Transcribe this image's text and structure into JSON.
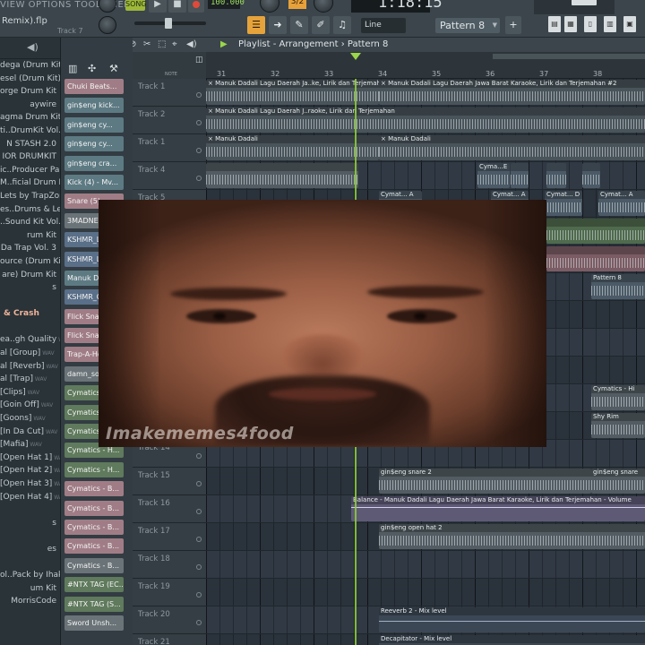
{
  "topbar": {
    "menu_text": "VIEW  OPTIONS  TOOLS  HELP",
    "file_name": "Remix).flp",
    "track_hint": "Track 7",
    "song_label": "SONG",
    "tempo": "100.000",
    "snap_value": "3/2",
    "time": "1:18:15",
    "snap_mode": "Line",
    "pattern": "Pattern 8"
  },
  "browser": {
    "items": [
      {
        "label": "dega (Drum Kit)",
        "kind": "item"
      },
      {
        "label": "esel (Drum Kit)",
        "kind": "item"
      },
      {
        "label": "orge Drum Kit",
        "kind": "item"
      },
      {
        "label": "aywire",
        "kind": "item"
      },
      {
        "label": "agma Drum Kit",
        "kind": "item"
      },
      {
        "label": "ti..DrumKit Vol. 3",
        "kind": "item"
      },
      {
        "label": "N STASH 2.0",
        "kind": "item"
      },
      {
        "label": "IOR DRUMKIT",
        "kind": "item"
      },
      {
        "label": "ic..Producer Pack",
        "kind": "item"
      },
      {
        "label": "M..ficial Drum Kit",
        "kind": "item"
      },
      {
        "label": "Lets by TrapZone",
        "kind": "item"
      },
      {
        "label": "es..Drums & Leads",
        "kind": "item"
      },
      {
        "label": "..Sound Kit Vol.8",
        "kind": "item"
      },
      {
        "label": "rum Kit",
        "kind": "item"
      },
      {
        "label": "Da Trap Vol. 3",
        "kind": "item"
      },
      {
        "label": "ource (Drum Kit)",
        "kind": "item"
      },
      {
        "label": "are) Drum Kit",
        "kind": "item"
      },
      {
        "label": "s",
        "kind": "item"
      },
      {
        "label": "",
        "kind": "item"
      },
      {
        "label": "& Crash",
        "kind": "group"
      },
      {
        "label": "",
        "kind": "item"
      },
      {
        "label": "ea..gh Quality",
        "kind": "audio"
      },
      {
        "label": "al [Group]",
        "kind": "audio"
      },
      {
        "label": "al [Reverb]",
        "kind": "audio"
      },
      {
        "label": "al [Trap]",
        "kind": "audio"
      },
      {
        "label": "[Clips]",
        "kind": "audio"
      },
      {
        "label": "[Goin Off]",
        "kind": "audio"
      },
      {
        "label": "[Goons]",
        "kind": "audio"
      },
      {
        "label": "[In Da Cut]",
        "kind": "audio"
      },
      {
        "label": "[Mafia]",
        "kind": "audio"
      },
      {
        "label": "[Open Hat 1]",
        "kind": "audio"
      },
      {
        "label": "[Open Hat 2]",
        "kind": "audio"
      },
      {
        "label": "[Open Hat 3]",
        "kind": "audio"
      },
      {
        "label": "[Open Hat 4]",
        "kind": "audio"
      },
      {
        "label": "",
        "kind": "item"
      },
      {
        "label": "s",
        "kind": "item"
      },
      {
        "label": "",
        "kind": "item"
      },
      {
        "label": "es",
        "kind": "item"
      },
      {
        "label": "",
        "kind": "item"
      },
      {
        "label": "ol..Pack by Ihaksi",
        "kind": "item"
      },
      {
        "label": "um Kit",
        "kind": "item"
      },
      {
        "label": "MorrisCode",
        "kind": "item"
      }
    ]
  },
  "channels": [
    {
      "label": "Chuki Beats...",
      "color": "pink"
    },
    {
      "label": "gin$eng kick...",
      "color": "teal"
    },
    {
      "label": "gin$eng cy...",
      "color": "teal"
    },
    {
      "label": "gin$eng cy...",
      "color": "teal"
    },
    {
      "label": "gin$eng cra...",
      "color": "teal"
    },
    {
      "label": "Kick (4) - Mv...",
      "color": "teal"
    },
    {
      "label": "Snare (5) -",
      "color": "pink"
    },
    {
      "label": "3MADNESS...",
      "color": "gray"
    },
    {
      "label": "KSHMR_Lo...",
      "color": "blue"
    },
    {
      "label": "KSHMR_Lo...",
      "color": "blue"
    },
    {
      "label": "Manuk Dadali",
      "color": "teal"
    },
    {
      "label": "KSHMR_Gr...",
      "color": "blue"
    },
    {
      "label": "Flick Snare",
      "color": "pink"
    },
    {
      "label": "Flick Snare",
      "color": "pink"
    },
    {
      "label": "Trap-A-Ho...",
      "color": "pink"
    },
    {
      "label": "damn_son...",
      "color": "gray"
    },
    {
      "label": "Cymatics -",
      "color": "green"
    },
    {
      "label": "Cymatics -",
      "color": "green"
    },
    {
      "label": "Cymatics -",
      "color": "green"
    },
    {
      "label": "Cymatics - H...",
      "color": "green"
    },
    {
      "label": "Cymatics - H...",
      "color": "green"
    },
    {
      "label": "Cymatics - B...",
      "color": "pink"
    },
    {
      "label": "Cymatics - B...",
      "color": "pink"
    },
    {
      "label": "Cymatics - B...",
      "color": "pink"
    },
    {
      "label": "Cymatics - B...",
      "color": "pink"
    },
    {
      "label": "Cymatics - B...",
      "color": "gray"
    },
    {
      "label": "#NTX TAG (EC...",
      "color": "green"
    },
    {
      "label": "#NTX TAG (S...",
      "color": "green"
    },
    {
      "label": "Sword Unsh...",
      "color": "gray"
    }
  ],
  "playlist": {
    "title": "Playlist - Arrangement › Pattern 8",
    "note_label": "NOTE",
    "bars": [
      "31",
      "32",
      "33",
      "34",
      "35",
      "36",
      "37",
      "38"
    ],
    "tracks": [
      {
        "label": "Track 1",
        "clips": [
          {
            "kind": "wave",
            "start": 0,
            "len": 193,
            "text": "× Manuk Dadali Lagu Daerah Ja..ke, Lirik dan Terjemahan #2"
          },
          {
            "kind": "wave",
            "start": 193,
            "len": 297,
            "text": "× Manuk Dadali Lagu Daerah Jawa Barat Karaoke, Lirik dan Terjemahan #2"
          }
        ]
      },
      {
        "label": "Track 2",
        "clips": [
          {
            "kind": "wave",
            "start": 0,
            "len": 490,
            "text": "× Manuk Dadali Lagu Daerah J..raoke, Lirik dan Terjemahan"
          }
        ]
      },
      {
        "label": "Track 1",
        "clips": [
          {
            "kind": "wave",
            "start": 0,
            "len": 193,
            "text": "× Manuk Dadali"
          },
          {
            "kind": "wave",
            "start": 193,
            "len": 297,
            "text": "× Manuk Dadali"
          }
        ]
      },
      {
        "label": "Track 4",
        "clips": [
          {
            "kind": "gray",
            "start": 0,
            "len": 170,
            "text": ""
          },
          {
            "kind": "slate",
            "start": 303,
            "len": 36,
            "text": "Cyma...E"
          },
          {
            "kind": "slate",
            "start": 340,
            "len": 20,
            "text": ""
          },
          {
            "kind": "slate",
            "start": 380,
            "len": 22,
            "text": ""
          },
          {
            "kind": "slate",
            "start": 420,
            "len": 20,
            "text": ""
          }
        ]
      },
      {
        "label": "Track 5",
        "clips": [
          {
            "kind": "slate",
            "start": 193,
            "len": 48,
            "text": "Cymat... A"
          },
          {
            "kind": "slate",
            "start": 318,
            "len": 42,
            "text": "Cymat... A"
          },
          {
            "kind": "slate",
            "start": 378,
            "len": 42,
            "text": "Cymat... D"
          },
          {
            "kind": "slate",
            "start": 438,
            "len": 52,
            "text": "Cymat... A"
          }
        ]
      },
      {
        "label": "Track 6",
        "clips": [
          {
            "kind": "green",
            "start": 380,
            "len": 110,
            "text": ""
          }
        ]
      },
      {
        "label": "Track 7",
        "clips": [
          {
            "kind": "pink",
            "start": 380,
            "len": 110,
            "text": ""
          }
        ]
      },
      {
        "label": "Track 8",
        "clips": [
          {
            "kind": "slate",
            "start": 430,
            "len": 60,
            "text": "Pattern 8"
          }
        ]
      },
      {
        "label": "Track 9",
        "clips": []
      },
      {
        "label": "Track 10",
        "clips": []
      },
      {
        "label": "Track 11",
        "clips": []
      },
      {
        "label": "Track 12",
        "clips": [
          {
            "kind": "gray",
            "start": 430,
            "len": 60,
            "text": "Cymatics - Hi"
          }
        ]
      },
      {
        "label": "Track 13",
        "clips": [
          {
            "kind": "gray",
            "start": 430,
            "len": 60,
            "text": "Shy Rim"
          }
        ]
      },
      {
        "label": "Track 14",
        "clips": []
      },
      {
        "label": "Track 15",
        "clips": [
          {
            "kind": "gray",
            "start": 193,
            "len": 237,
            "text": "gin$eng snare 2"
          },
          {
            "kind": "gray",
            "start": 430,
            "len": 60,
            "text": "gin$eng snare"
          }
        ]
      },
      {
        "label": "Track 16",
        "clips": [
          {
            "kind": "purple",
            "start": 162,
            "len": 328,
            "text": "Balance - Manuk Dadali Lagu Daerah Jawa Barat Karaoke, Lirik dan Terjemahan - Volume"
          }
        ]
      },
      {
        "label": "Track 17",
        "clips": [
          {
            "kind": "gray",
            "start": 193,
            "len": 297,
            "text": "gin$eng open hat 2"
          }
        ]
      },
      {
        "label": "Track 18",
        "clips": []
      },
      {
        "label": "Track 19",
        "clips": []
      },
      {
        "label": "Track 20",
        "clips": [
          {
            "kind": "auto",
            "start": 193,
            "len": 297,
            "text": "Reeverb 2 - Mix level"
          }
        ]
      },
      {
        "label": "Track 21",
        "clips": [
          {
            "kind": "auto",
            "start": 193,
            "len": 297,
            "text": "Decapitator - Mix level"
          }
        ]
      }
    ]
  },
  "meme": {
    "watermark": "Imakememes4food"
  }
}
